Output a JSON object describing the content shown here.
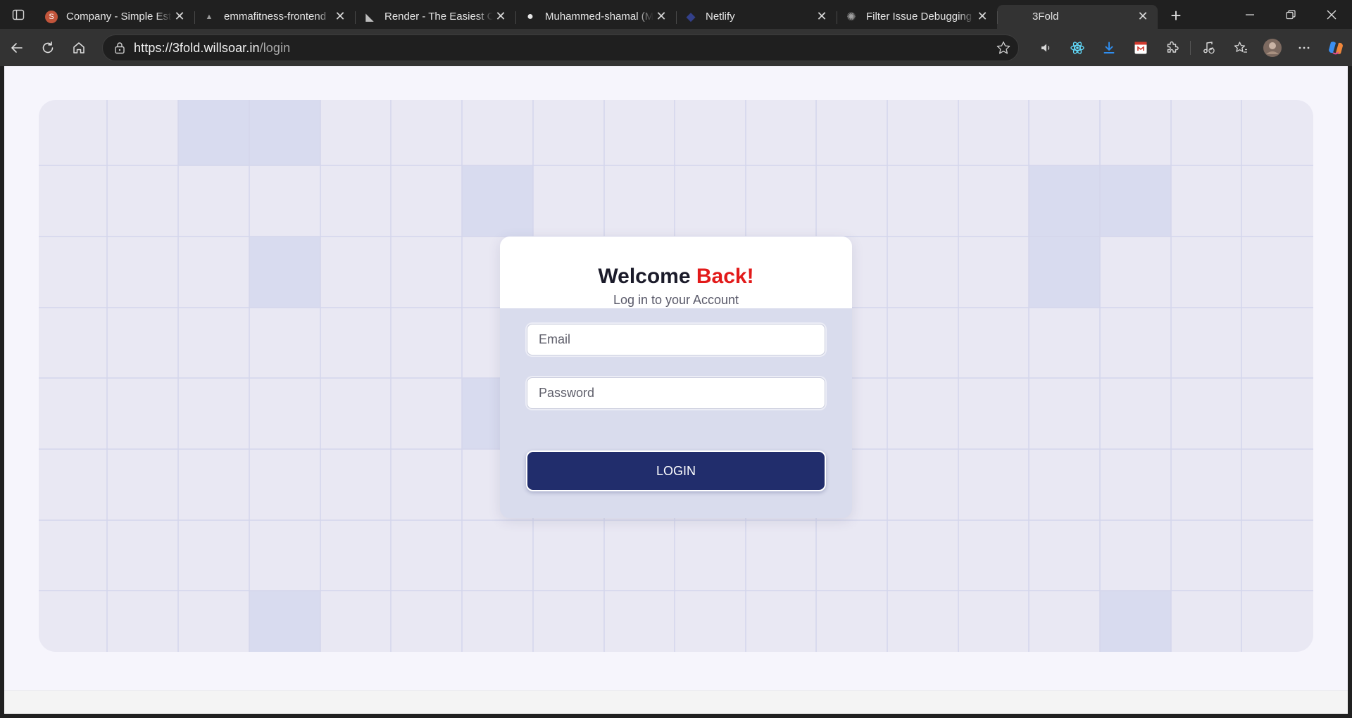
{
  "browser": {
    "tabs": [
      {
        "title": "Company - Simple Esti",
        "favicon": "s-circle-icon",
        "favicon_color": "#c2553b",
        "favicon_glyph": "S",
        "active": false
      },
      {
        "title": "emmafitness-frontend",
        "favicon": "triangle-icon",
        "favicon_color": "#9a9a9a",
        "favicon_glyph": "▲",
        "active": false
      },
      {
        "title": "Render - The Easiest Cl",
        "favicon": "render-icon",
        "favicon_color": "#bdbdbd",
        "favicon_glyph": "◣",
        "active": false
      },
      {
        "title": "Muhammed-shamal (M",
        "favicon": "github-icon",
        "favicon_color": "#e6e6e6",
        "favicon_glyph": "●",
        "active": false
      },
      {
        "title": "Netlify",
        "favicon": "netlify-icon",
        "favicon_color": "#2c3a7a",
        "favicon_glyph": "◆",
        "active": false
      },
      {
        "title": "Filter Issue Debugging",
        "favicon": "openai-icon",
        "favicon_color": "#9a9a9a",
        "favicon_glyph": "✺",
        "active": false
      },
      {
        "title": "3Fold",
        "favicon": "",
        "favicon_color": "",
        "favicon_glyph": "",
        "active": true
      }
    ],
    "url_host": "https://3fold.willsoar.in",
    "url_path": "/login"
  },
  "login": {
    "title_part1": "Welcome",
    "title_part2": "Back!",
    "subtitle": "Log in to your Account",
    "email_placeholder": "Email",
    "password_placeholder": "Password",
    "button_label": "LOGIN"
  },
  "colors": {
    "accent_red": "#e21a1a",
    "button_navy": "#212d6c",
    "page_bg": "#f6f5fc"
  }
}
